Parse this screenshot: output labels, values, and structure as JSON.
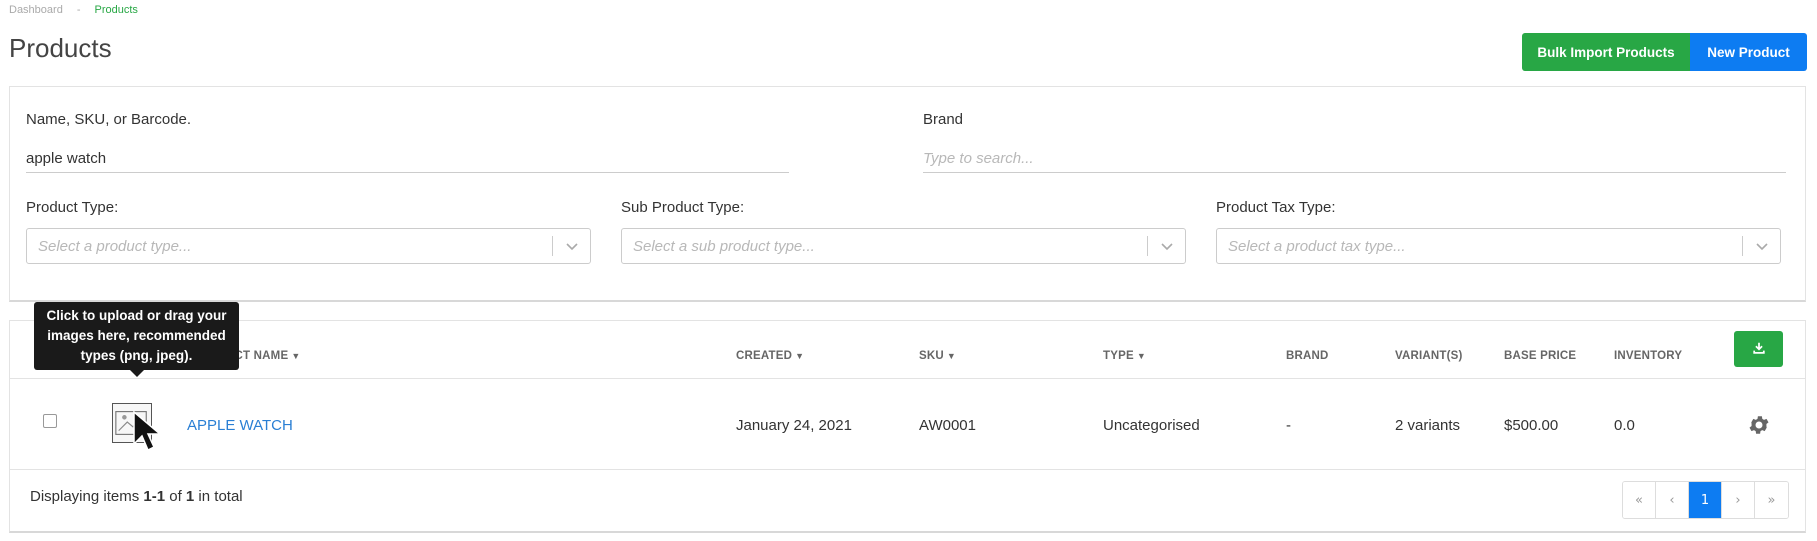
{
  "breadcrumb": {
    "home": "Dashboard",
    "separator": "-",
    "current": "Products"
  },
  "page": {
    "title": "Products"
  },
  "actions": {
    "bulk_import": "Bulk Import Products",
    "new_product": "New Product"
  },
  "filters": {
    "search": {
      "label": "Name, SKU, or Barcode.",
      "value": "apple watch"
    },
    "brand": {
      "label": "Brand",
      "placeholder": "Type to search..."
    },
    "product_type": {
      "label": "Product Type:",
      "placeholder": "Select a product type..."
    },
    "sub_product_type": {
      "label": "Sub Product Type:",
      "placeholder": "Select a sub product type..."
    },
    "tax_type": {
      "label": "Product Tax Type:",
      "placeholder": "Select a product tax type..."
    }
  },
  "table": {
    "columns": {
      "product_name": "PRODUCT NAME",
      "created": "CREATED",
      "sku": "SKU",
      "type": "TYPE",
      "brand": "BRAND",
      "variants": "VARIANT(S)",
      "base_price": "BASE PRICE",
      "inventory": "INVENTORY"
    },
    "rows": [
      {
        "name": "APPLE WATCH",
        "created": "January 24, 2021",
        "sku": "AW0001",
        "type": "Uncategorised",
        "brand": "-",
        "variants": "2 variants",
        "base_price": "$500.00",
        "inventory": "0.0"
      }
    ],
    "footer": {
      "prefix": "Displaying items ",
      "range": "1-1",
      "middle": " of ",
      "total": "1",
      "suffix": " in total"
    },
    "pagination": {
      "first": "«",
      "prev": "‹",
      "current": "1",
      "next": "›",
      "last": "»"
    }
  },
  "tooltip": {
    "text": "Click to upload or drag your images here, recommended types (png, jpeg)."
  },
  "colors": {
    "primary": "#0d7cf2",
    "success": "#28a745",
    "link": "#2a7fd4",
    "tooltip_bg": "#1a1a1a"
  },
  "icons": {
    "export": "download-icon",
    "row_actions": "gear-icon",
    "select_toggle": "chevron-down-icon",
    "cursor": "pointer-cursor-icon",
    "image": "image-upload-icon"
  }
}
